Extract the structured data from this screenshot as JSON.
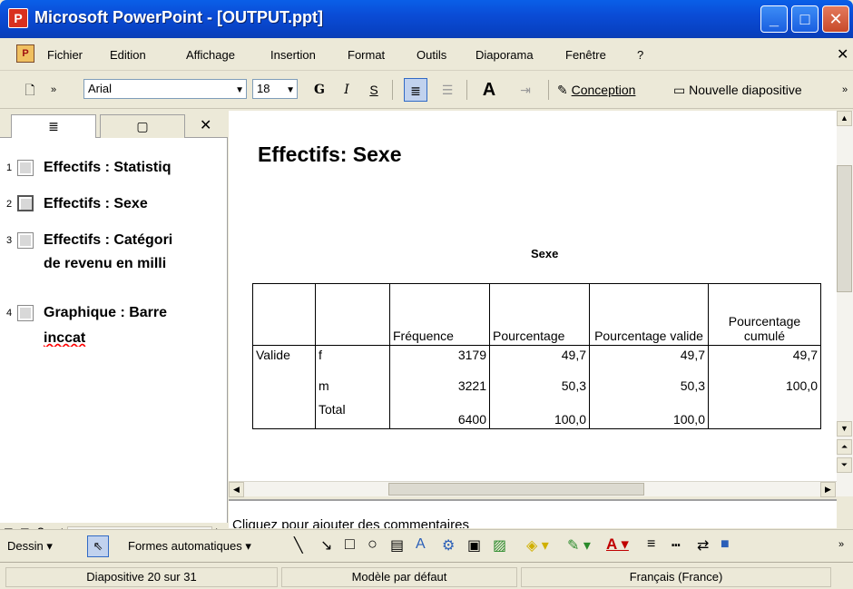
{
  "window": {
    "title": "Microsoft PowerPoint - [OUTPUT.ppt]"
  },
  "menubar": {
    "items": [
      "Fichier",
      "Edition",
      "Affichage",
      "Insertion",
      "Format",
      "Outils",
      "Diaporama",
      "Fenêtre",
      "?"
    ]
  },
  "toolbar": {
    "font_name": "Arial",
    "font_size": "18",
    "bold": "G",
    "italic": "I",
    "shadow": "S",
    "design_label": "Conception",
    "new_slide_label": "Nouvelle diapositive"
  },
  "outline": {
    "items": [
      {
        "num": "1",
        "text": "Effectifs : Statistiq"
      },
      {
        "num": "2",
        "text": "Effectifs : Sexe"
      },
      {
        "num": "3",
        "text": "Effectifs : Catégori",
        "text2": "de revenu en milli"
      },
      {
        "num": "4",
        "text": "Graphique : Barre",
        "text2": "inccat"
      }
    ]
  },
  "slide": {
    "title": "Effectifs: Sexe",
    "table_caption": "Sexe",
    "headers": [
      "",
      "",
      "Fréquence",
      "Pourcentage",
      "Pourcentage valide",
      "Pourcentage cumulé"
    ],
    "row_label": "Valide",
    "rows": [
      {
        "cat": "f",
        "freq": "3179",
        "pct": "49,7",
        "valid": "49,7",
        "cum": "49,7"
      },
      {
        "cat": "m",
        "freq": "3221",
        "pct": "50,3",
        "valid": "50,3",
        "cum": "100,0"
      },
      {
        "cat": "Total",
        "freq": "6400",
        "pct": "100,0",
        "valid": "100,0",
        "cum": ""
      }
    ]
  },
  "notes": {
    "placeholder": "Cliquez pour ajouter des commentaires"
  },
  "drawbar": {
    "draw_label": "Dessin",
    "autoshapes_label": "Formes automatiques"
  },
  "status": {
    "slide_info": "Diapositive 20 sur 31",
    "template": "Modèle par défaut",
    "language": "Français (France)"
  }
}
